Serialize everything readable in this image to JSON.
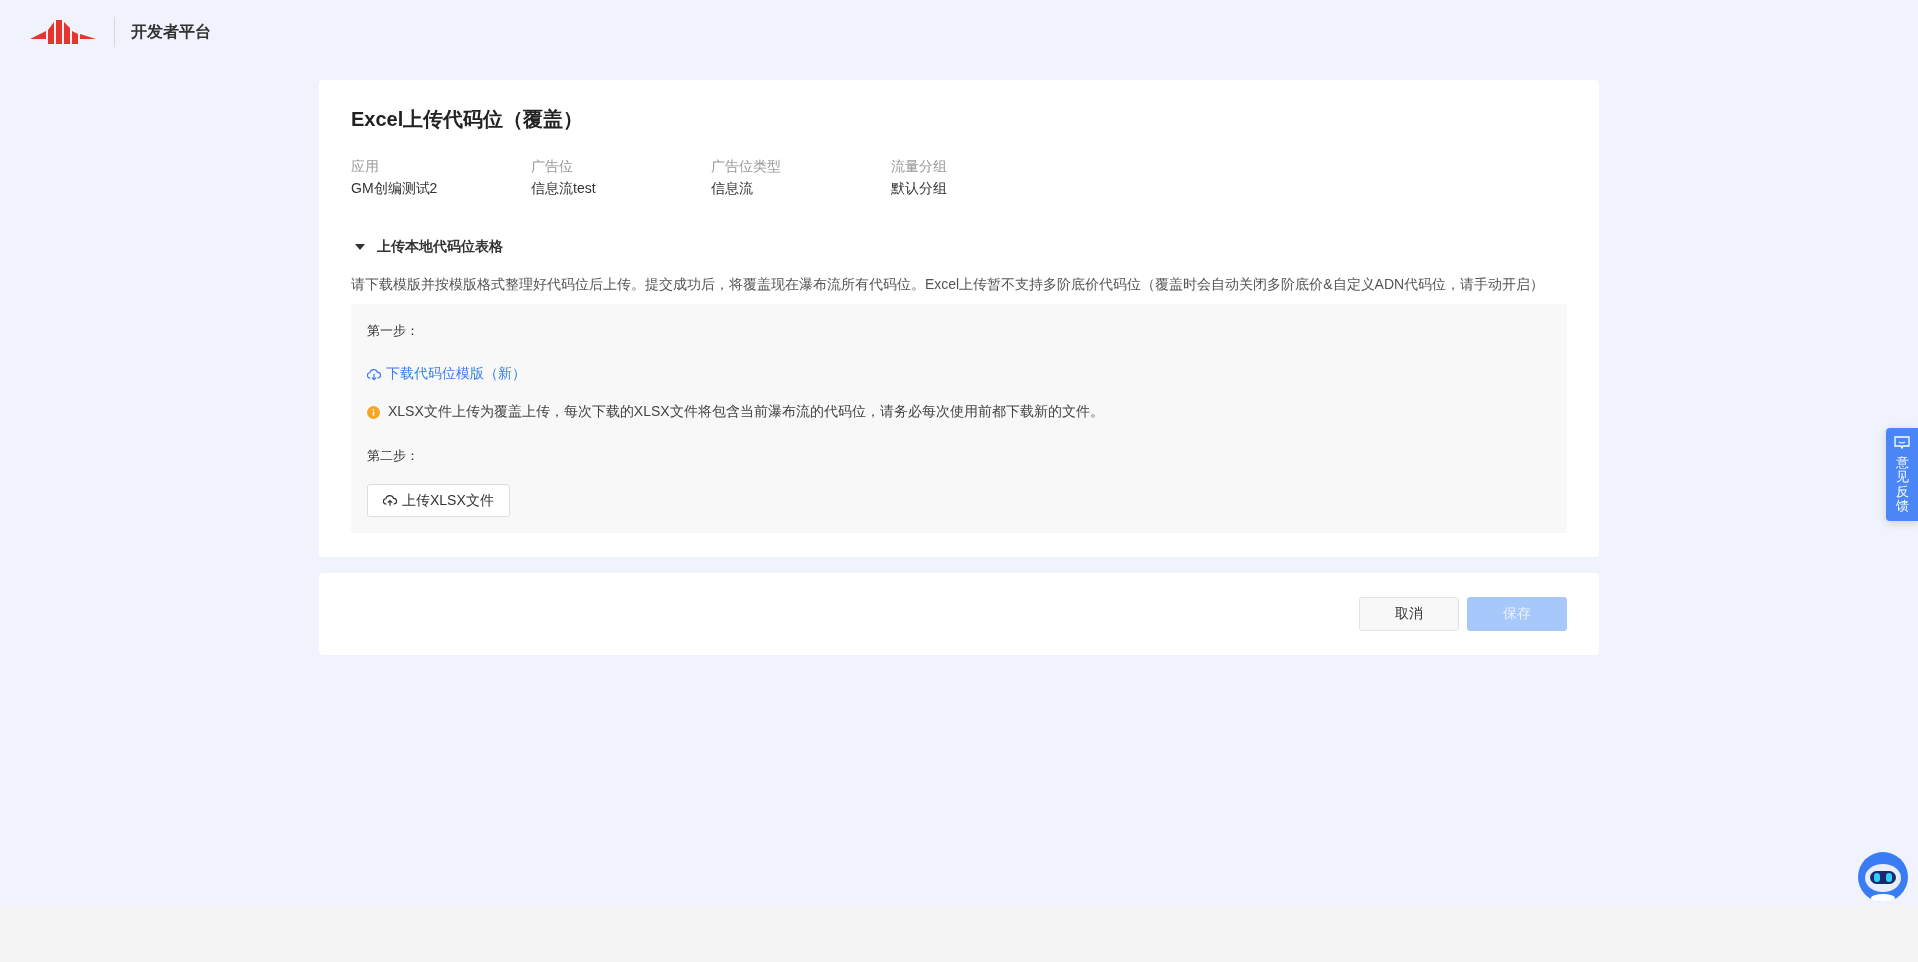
{
  "header": {
    "platform_name": "开发者平台"
  },
  "title": "Excel上传代码位（覆盖）",
  "info": [
    {
      "label": "应用",
      "value": "GM创编测试2"
    },
    {
      "label": "广告位",
      "value": "信息流test"
    },
    {
      "label": "广告位类型",
      "value": "信息流"
    },
    {
      "label": "流量分组",
      "value": "默认分组"
    }
  ],
  "section": {
    "title": "上传本地代码位表格",
    "expanded": true,
    "description": "请下载模版并按模版格式整理好代码位后上传。提交成功后，将覆盖现在瀑布流所有代码位。Excel上传暂不支持多阶底价代码位（覆盖时会自动关闭多阶底价&自定义ADN代码位，请手动开启）",
    "step1_label": "第一步：",
    "download_link": "下载代码位模版（新）",
    "warning": "XLSX文件上传为覆盖上传，每次下载的XLSX文件将包含当前瀑布流的代码位，请务必每次使用前都下载新的文件。",
    "step2_label": "第二步：",
    "upload_button": "上传XLSX文件"
  },
  "footer": {
    "buttons": [
      {
        "label": "取消",
        "kind": "default",
        "disabled": false
      },
      {
        "label": "保存",
        "kind": "primary",
        "disabled": true
      }
    ]
  },
  "feedback_tab": "意见反馈"
}
